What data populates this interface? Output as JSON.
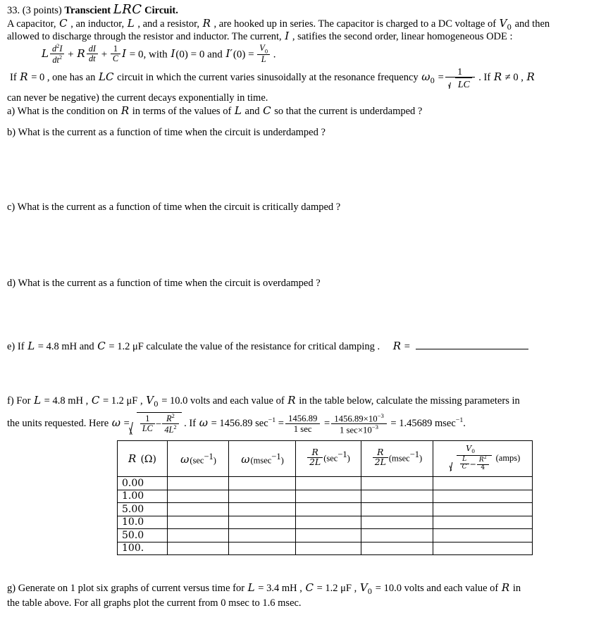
{
  "problem": {
    "number": "33.",
    "points": "(3 points)",
    "title_bold": "Transcient",
    "title_math": "LRC",
    "title_tail": "Circuit."
  },
  "intro": {
    "line1_a": "A capacitor,",
    "var_C": "C",
    "line1_b": ", an inductor,",
    "var_L": "L",
    "line1_c": ", and a resistor,",
    "var_R": "R",
    "line1_d": ", are hooked up in series. The capacitor is charged to a DC voltage  of",
    "var_V0": "V",
    "var_V0_sub": "0",
    "line1_e": "and then",
    "line2_a": "allowed to discharge through the resistor and inductor.  The current,",
    "var_I": "I",
    "line2_b": ", satifies the second order, linear homogeneous ODE :"
  },
  "ode": {
    "L": "L",
    "d2I": "d",
    "d2I_sup": "2",
    "d2I_I": "I",
    "dt2": "dt",
    "dt2_sup": "2",
    "plus1": "+",
    "R": "R",
    "dI": "dI",
    "dt": "dt",
    "plus2": "+",
    "one": "1",
    "C": "C",
    "I": "I",
    "eq0": "= 0",
    "with": ", with",
    "I0": "I",
    "I0_arg": "(0) = 0",
    "and": "and",
    "Ip0": "I",
    "Ip0_prime": "′",
    "Ip0_arg": "(0) =",
    "V0_num": "V",
    "V0_num_sub": "0",
    "L_den": "L",
    "period": "."
  },
  "resonance": {
    "if": "If",
    "R": "R",
    "eq0": "= 0",
    "text1": ", one has an",
    "LC": "LC",
    "text2": "circuit in which the current varies sinusoidally at the resonance frequency",
    "omega": "ω",
    "omega_sub": "0",
    "eq": "=",
    "num": "1",
    "den_LC": "LC",
    "text3": ". If",
    "R2": "R",
    "neq0": "≠ 0 ,",
    "R3": "R"
  },
  "negline": "can never be negative) the current decays exponentially in time.",
  "parts": {
    "a": {
      "label": "a)",
      "text1": "What is the condition on",
      "var1": "R",
      "text2": "in terms of the values of",
      "var2": "L",
      "text3": "and",
      "var3": "C",
      "text4": "so that the current is underdamped ?"
    },
    "b": {
      "label": "b)",
      "text": "What is the current as a function of time when the circuit is underdamped ?"
    },
    "c": {
      "label": "c)",
      "text": "What is the current as a function of time when the circuit is critically damped ?"
    },
    "d": {
      "label": "d)",
      "text": "What is the current as a function of time when the circuit is overdamped ?"
    },
    "e": {
      "label": "e)",
      "text1": "If",
      "varL": "L",
      "valL": "= 4.8 mH",
      "and": "and",
      "varC": "C",
      "valC": "= 1.2 μF",
      "text2": "calculate the value of the resistance for critical damping .",
      "varR": "R",
      "eq": "="
    },
    "f": {
      "label": "f)",
      "text1": "For",
      "varL": "L",
      "valL": "= 4.8 mH ,",
      "varC": "C",
      "valC": "= 1.2 μF ,",
      "varV0": "V",
      "varV0_sub": "0",
      "valV0": "= 10.0 volts and each value of",
      "varR": "R",
      "text2": "in the table below, calculate the missing parameters in",
      "line2_a": "the units requested. Here",
      "omega": "ω",
      "eq1": "=",
      "frac1_num": "1",
      "frac1_den": "LC",
      "minus": "−",
      "frac2_num": "R",
      "frac2_num_sup": "2",
      "frac2_den": "4L",
      "frac2_den_sup": "2",
      "text3": ". If",
      "omega2": "ω",
      "val_omega": "= 1456.89 sec",
      "val_omega_sup": "−1",
      "eq2": "=",
      "f3_num": "1456.89",
      "f3_den": "1 sec",
      "eq3": "=",
      "f4_num": "1456.89×10",
      "f4_num_sup": "−3",
      "f4_den": "1 sec×10",
      "f4_den_sup": "−3",
      "eq4": "= 1.45689 msec",
      "eq4_sup": "−1",
      "period": "."
    },
    "g": {
      "label": "g)",
      "text1": "Generate on 1 plot six graphs of current versus time for",
      "varL": "L",
      "valL": "= 3.4 mH ,",
      "varC": "C",
      "valC": "= 1.2 μF ,",
      "varV0": "V",
      "varV0_sub": "0",
      "valV0": "= 10.0 volts and each value of",
      "varR": "R",
      "text2": "in",
      "line2": "the table above. For all graphs plot the current from 0 msec to 1.6 msec."
    }
  },
  "table": {
    "headers": [
      {
        "id": "col-R",
        "main": "R",
        "unit": "(Ω)",
        "kind": "simple"
      },
      {
        "id": "col-omega-sec",
        "main": "ω",
        "unit": "(sec",
        "sup": "−1",
        "unit_end": ")",
        "kind": "simple"
      },
      {
        "id": "col-omega-msec",
        "main": "ω",
        "unit": "(msec",
        "sup": "−1",
        "unit_end": ")",
        "kind": "simple"
      },
      {
        "id": "col-r2l-sec",
        "num": "R",
        "den": "2L",
        "unit": "(sec",
        "sup": "−1",
        "unit_end": ")",
        "kind": "frac"
      },
      {
        "id": "col-r2l-msec",
        "num": "R",
        "den": "2L",
        "unit": "(msec",
        "sup": "−1",
        "unit_end": ")",
        "kind": "frac"
      },
      {
        "id": "col-amps",
        "num_V": "V",
        "num_V_sub": "0",
        "den_L": "L",
        "den_C": "C",
        "den_minus": "−",
        "den_R": "R",
        "den_R_sup": "2",
        "den_4": "4",
        "unit": "(amps)",
        "kind": "bigfrac"
      }
    ],
    "rows": [
      {
        "R": "0.00",
        "cells": [
          "",
          "",
          "",
          "",
          ""
        ]
      },
      {
        "R": "1.00",
        "cells": [
          "",
          "",
          "",
          "",
          ""
        ]
      },
      {
        "R": "5.00",
        "cells": [
          "",
          "",
          "",
          "",
          ""
        ]
      },
      {
        "R": "10.0",
        "cells": [
          "",
          "",
          "",
          "",
          ""
        ]
      },
      {
        "R": "50.0",
        "cells": [
          "",
          "",
          "",
          "",
          ""
        ]
      },
      {
        "R": "100.",
        "cells": [
          "",
          "",
          "",
          "",
          ""
        ]
      }
    ]
  }
}
